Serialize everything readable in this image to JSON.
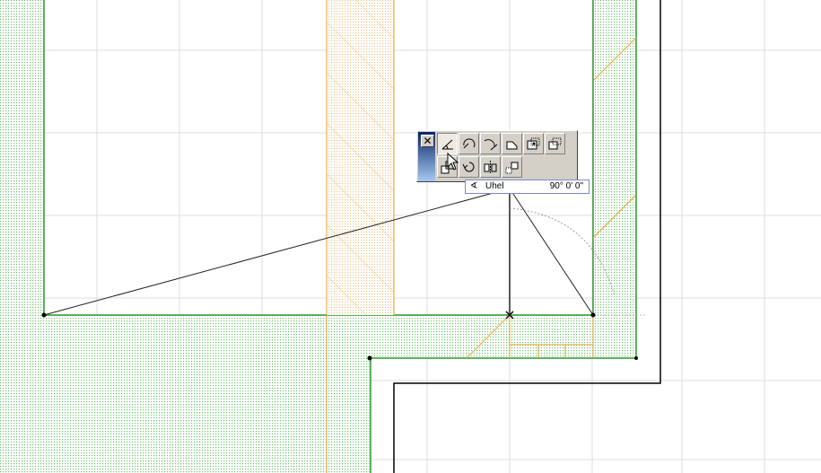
{
  "palette": {
    "close_icon": "close-icon",
    "tools_row1": [
      {
        "name": "tool-angle",
        "icon": "angle-arc-icon",
        "active": true
      },
      {
        "name": "tool-arc",
        "icon": "arc-icon",
        "active": false
      },
      {
        "name": "tool-tangent-arc",
        "icon": "tangent-arc-icon",
        "active": false
      },
      {
        "name": "tool-offset",
        "icon": "offset-shape-icon",
        "active": false
      },
      {
        "name": "tool-snap-center",
        "icon": "snap-center-icon",
        "active": false
      },
      {
        "name": "tool-snap-point",
        "icon": "snap-point-icon",
        "active": false
      }
    ],
    "tools_row2": [
      {
        "name": "tool-copy",
        "icon": "copy-icon",
        "active": false
      },
      {
        "name": "tool-rotate",
        "icon": "rotate-icon",
        "active": false
      },
      {
        "name": "tool-mirror",
        "icon": "mirror-icon",
        "active": false
      },
      {
        "name": "tool-multiply",
        "icon": "multiply-icon",
        "active": false
      }
    ]
  },
  "tracker": {
    "label": "Uhel",
    "value": "90° 0' 0\""
  },
  "colors": {
    "wall_green": "#2e9a2e",
    "wall_fill": "#cfe9cf",
    "column_orange": "#e8a030",
    "grid": "#dcdcdc"
  }
}
